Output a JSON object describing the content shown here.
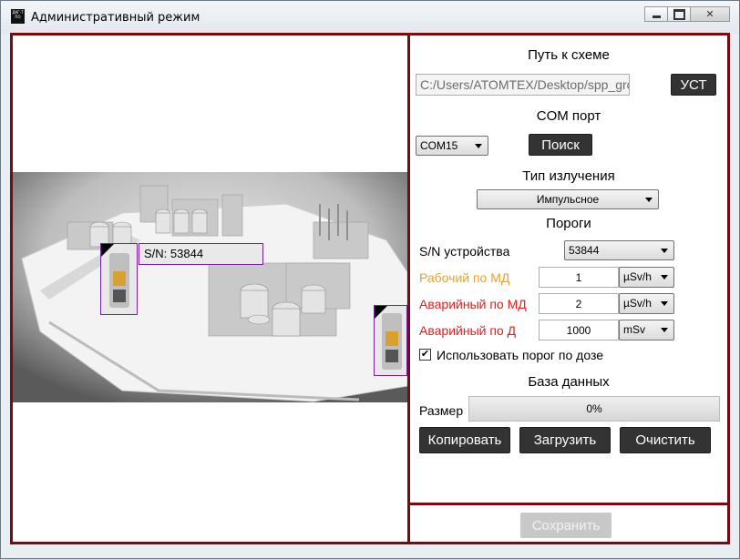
{
  "window": {
    "title": "Административный режим",
    "icon_text": "ДКГ-Т ПО"
  },
  "scene": {
    "sn_label": "S/N: 53844"
  },
  "panel": {
    "scheme_title": "Путь к схеме",
    "path_value": "C:/Users/ATOMTEX/Desktop/spp_grc",
    "set_button": "УСТ",
    "com_title": "COM порт",
    "com_value": "COM15",
    "search_button": "Поиск",
    "radiation_title": "Тип излучения",
    "radiation_value": "Импульсное",
    "thresholds_title": "Пороги",
    "sn_device_label": "S/N устройства",
    "sn_device_value": "53844",
    "work_md_label": "Рабочий по МД",
    "work_md_value": "1",
    "work_md_unit": "µSv/h",
    "alarm_md_label": "Аварийный по МД",
    "alarm_md_value": "2",
    "alarm_md_unit": "µSv/h",
    "alarm_d_label": "Аварийный по Д",
    "alarm_d_value": "1000",
    "alarm_d_unit": "mSv",
    "use_dose_threshold_label": "Использовать порог по дозе",
    "use_dose_threshold_checked": true,
    "database_title": "База данных",
    "size_label": "Размер",
    "size_progress_text": "0%",
    "size_progress_fraction": 0,
    "copy_button": "Копировать",
    "load_button": "Загрузить",
    "clear_button": "Очистить",
    "save_button": "Сохранить"
  },
  "colors": {
    "border": "#7a0a12",
    "work_label": "#f0a020",
    "alarm_label": "#e02020",
    "marker": "#7a1fa2"
  }
}
